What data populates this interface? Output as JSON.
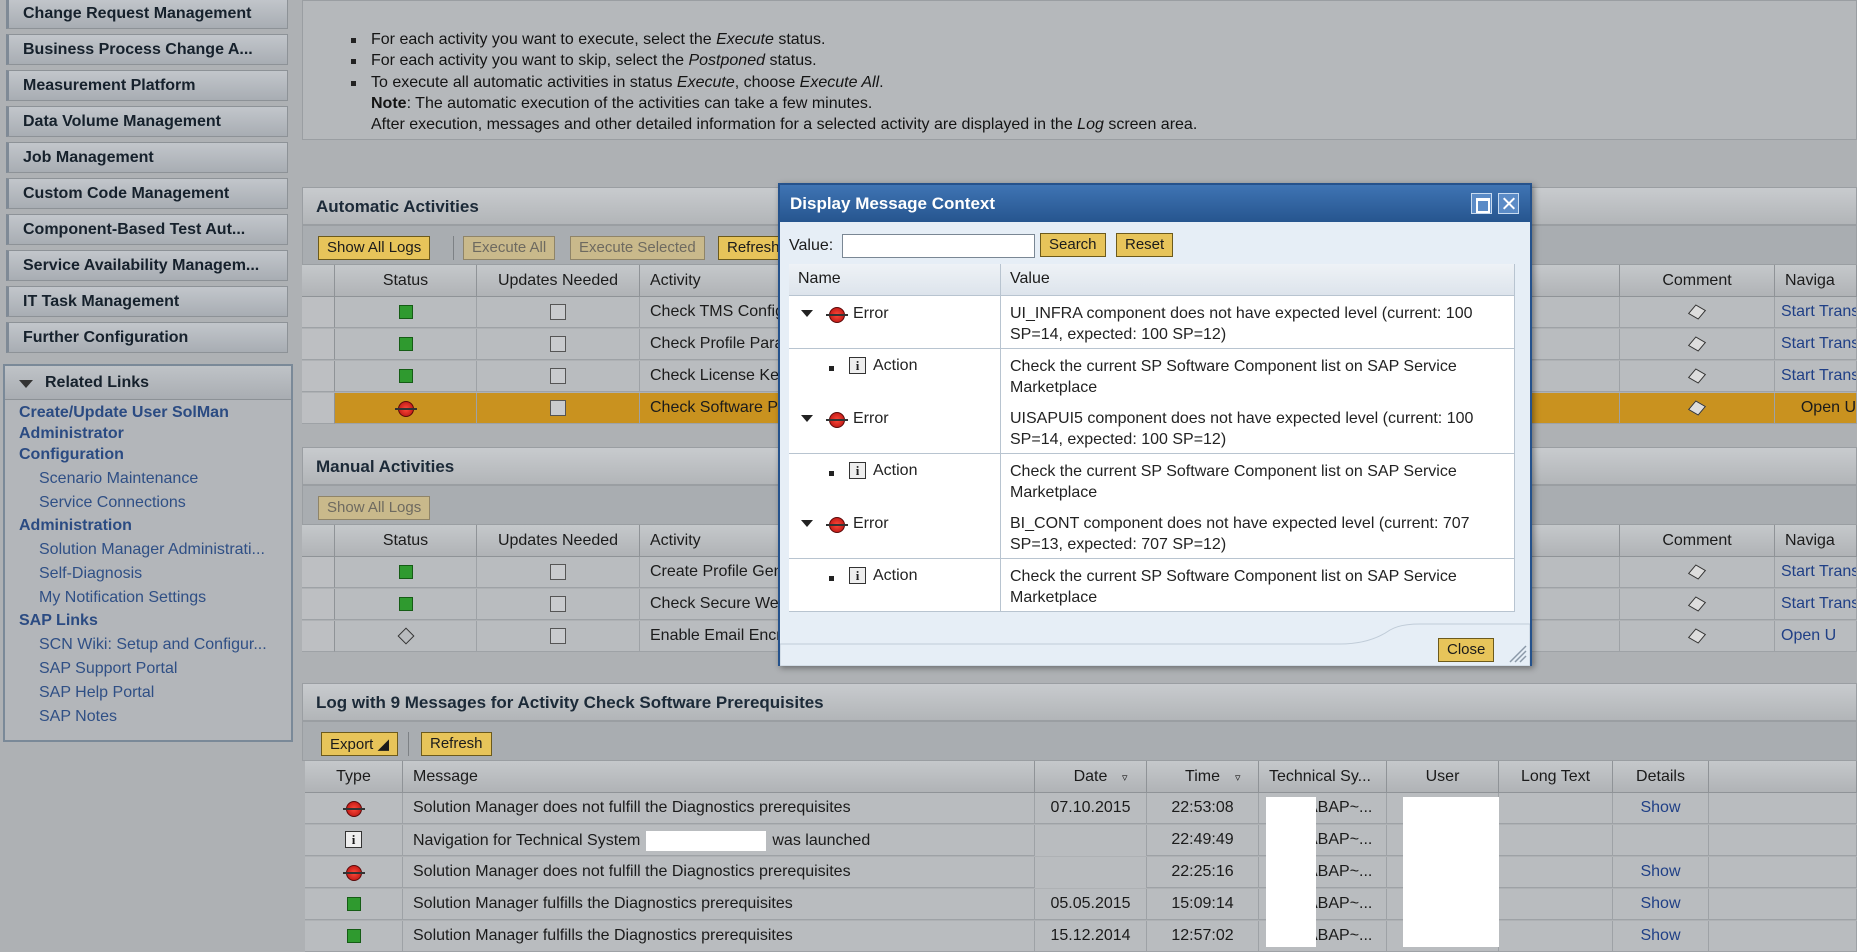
{
  "nav": {
    "items": [
      "Change Request Management",
      "Business Process Change A...",
      "Measurement Platform",
      "Data Volume Management",
      "Job Management",
      "Custom Code Management",
      "Component-Based Test Aut...",
      "Service Availability Managem...",
      "IT Task Management",
      "Further Configuration"
    ]
  },
  "related_links": {
    "title": "Related Links",
    "items": [
      {
        "label": "Create/Update User SolMan",
        "type": "header"
      },
      {
        "label": "Administrator",
        "type": "header"
      },
      {
        "label": "Configuration",
        "type": "header"
      },
      {
        "label": "Scenario Maintenance",
        "type": "sub"
      },
      {
        "label": "Service Connections",
        "type": "sub"
      },
      {
        "label": "Administration",
        "type": "header"
      },
      {
        "label": "Solution Manager Administrati...",
        "type": "sub"
      },
      {
        "label": "Self-Diagnosis",
        "type": "sub"
      },
      {
        "label": "My Notification Settings",
        "type": "sub"
      },
      {
        "label": "SAP Links",
        "type": "header"
      },
      {
        "label": "SCN Wiki: Setup and Configur...",
        "type": "sub"
      },
      {
        "label": "SAP Support Portal",
        "type": "sub"
      },
      {
        "label": "SAP Help Portal",
        "type": "sub"
      },
      {
        "label": "SAP Notes",
        "type": "sub"
      }
    ]
  },
  "instructions": {
    "lines": [
      {
        "bullet": true,
        "pre": "For each activity you want to execute, select the ",
        "em": "Execute",
        "post": " status."
      },
      {
        "bullet": true,
        "pre": "For each activity you want to skip, select the ",
        "em": "Postponed",
        "post": " status."
      },
      {
        "bullet": true,
        "pre": "To execute all automatic activities in status ",
        "em": "Execute",
        "post": ", choose ",
        "em2": "Execute All",
        "post2": "."
      },
      {
        "bullet": false,
        "strong": "Note",
        "post": ": The automatic execution of the activities can take a few minutes."
      },
      {
        "bullet": false,
        "pre": "After execution, messages and other detailed information for a selected activity are displayed in the ",
        "em": "Log",
        "post": " screen area."
      }
    ]
  },
  "automatic": {
    "title": "Automatic Activities",
    "buttons": {
      "show_all_logs": "Show All Logs",
      "execute_all": "Execute All",
      "execute_selected": "Execute Selected",
      "refresh": "Refresh"
    },
    "headers": {
      "status": "Status",
      "updates": "Updates Needed",
      "activity": "Activity",
      "comment": "Comment",
      "navigation": "Naviga"
    },
    "rows": [
      {
        "status": "green",
        "activity": "Check TMS Configu",
        "nav": "Start Trans"
      },
      {
        "status": "green",
        "activity": "Check Profile Paran",
        "nav": "Start Trans"
      },
      {
        "status": "green",
        "activity": "Check License Key",
        "nav": "Start Trans"
      },
      {
        "status": "error",
        "activity": "Check Software Pr",
        "nav": "Open U"
      }
    ]
  },
  "manual": {
    "title": "Manual Activities",
    "buttons": {
      "show_all_logs": "Show All Logs"
    },
    "headers": {
      "status": "Status",
      "updates": "Updates Needed",
      "activity": "Activity",
      "comment": "Comment",
      "navigation": "Naviga"
    },
    "rows": [
      {
        "status": "green",
        "activity": "Create Profile Gene",
        "nav": "Start Trans"
      },
      {
        "status": "green",
        "activity": "Check Secure Web",
        "nav": "Start Trans"
      },
      {
        "status": "diamond",
        "activity": "Enable Email Encryp",
        "nav": "Open U"
      }
    ]
  },
  "log": {
    "title": "Log with 9 Messages for Activity Check Software Prerequisites",
    "buttons": {
      "export": "Export",
      "refresh": "Refresh"
    },
    "headers": {
      "type": "Type",
      "message": "Message",
      "date": "Date",
      "time": "Time",
      "tech": "Technical Sy...",
      "user": "User",
      "long": "Long Text",
      "details": "Details"
    },
    "rows": [
      {
        "type": "error",
        "message": "Solution Manager does not fulfill the Diagnostics prerequisites",
        "date": "07.10.2015",
        "time": "22:53:08",
        "tech": "ABAP~...",
        "details": "Show"
      },
      {
        "type": "info",
        "message": "Navigation for Technical System",
        "message_suffix": "was launched",
        "date": "",
        "time": "22:49:49",
        "tech": "ABAP~...",
        "details": ""
      },
      {
        "type": "error",
        "message": "Solution Manager does not fulfill the Diagnostics prerequisites",
        "date": "",
        "time": "22:25:16",
        "tech": "ABAP~...",
        "details": "Show"
      },
      {
        "type": "green",
        "message": "Solution Manager fulfills the Diagnostics prerequisites",
        "date": "05.05.2015",
        "time": "15:09:14",
        "tech": "ABAP~...",
        "details": "Show"
      },
      {
        "type": "green",
        "message": "Solution Manager fulfills the Diagnostics prerequisites",
        "date": "15.12.2014",
        "time": "12:57:02",
        "tech": "ABAP~...",
        "details": "Show"
      }
    ]
  },
  "dialog": {
    "title": "Display Message Context",
    "value_label": "Value:",
    "value": "",
    "search": "Search",
    "reset": "Reset",
    "col_name": "Name",
    "col_value": "Value",
    "rows": [
      {
        "level": 0,
        "icon": "error",
        "name": "Error",
        "value1": "UI_INFRA component does not have expected level (current: 100",
        "value2": "SP=14, expected: 100 SP=12)"
      },
      {
        "level": 1,
        "icon": "info",
        "name": "Action",
        "value1": "Check the current SP Software Component list on SAP Service",
        "value2": "Marketplace"
      },
      {
        "level": 0,
        "icon": "error",
        "name": "Error",
        "value1": "UISAPUI5 component does not have expected level (current: 100",
        "value2": "SP=14, expected: 100 SP=12)"
      },
      {
        "level": 1,
        "icon": "info",
        "name": "Action",
        "value1": "Check the current SP Software Component list on SAP Service",
        "value2": "Marketplace"
      },
      {
        "level": 0,
        "icon": "error",
        "name": "Error",
        "value1": "BI_CONT component does not have expected level (current: 707",
        "value2": "SP=13, expected: 707 SP=12)"
      },
      {
        "level": 1,
        "icon": "info",
        "name": "Action",
        "value1": "Check the current SP Software Component list on SAP Service",
        "value2": "Marketplace"
      }
    ],
    "close": "Close"
  }
}
